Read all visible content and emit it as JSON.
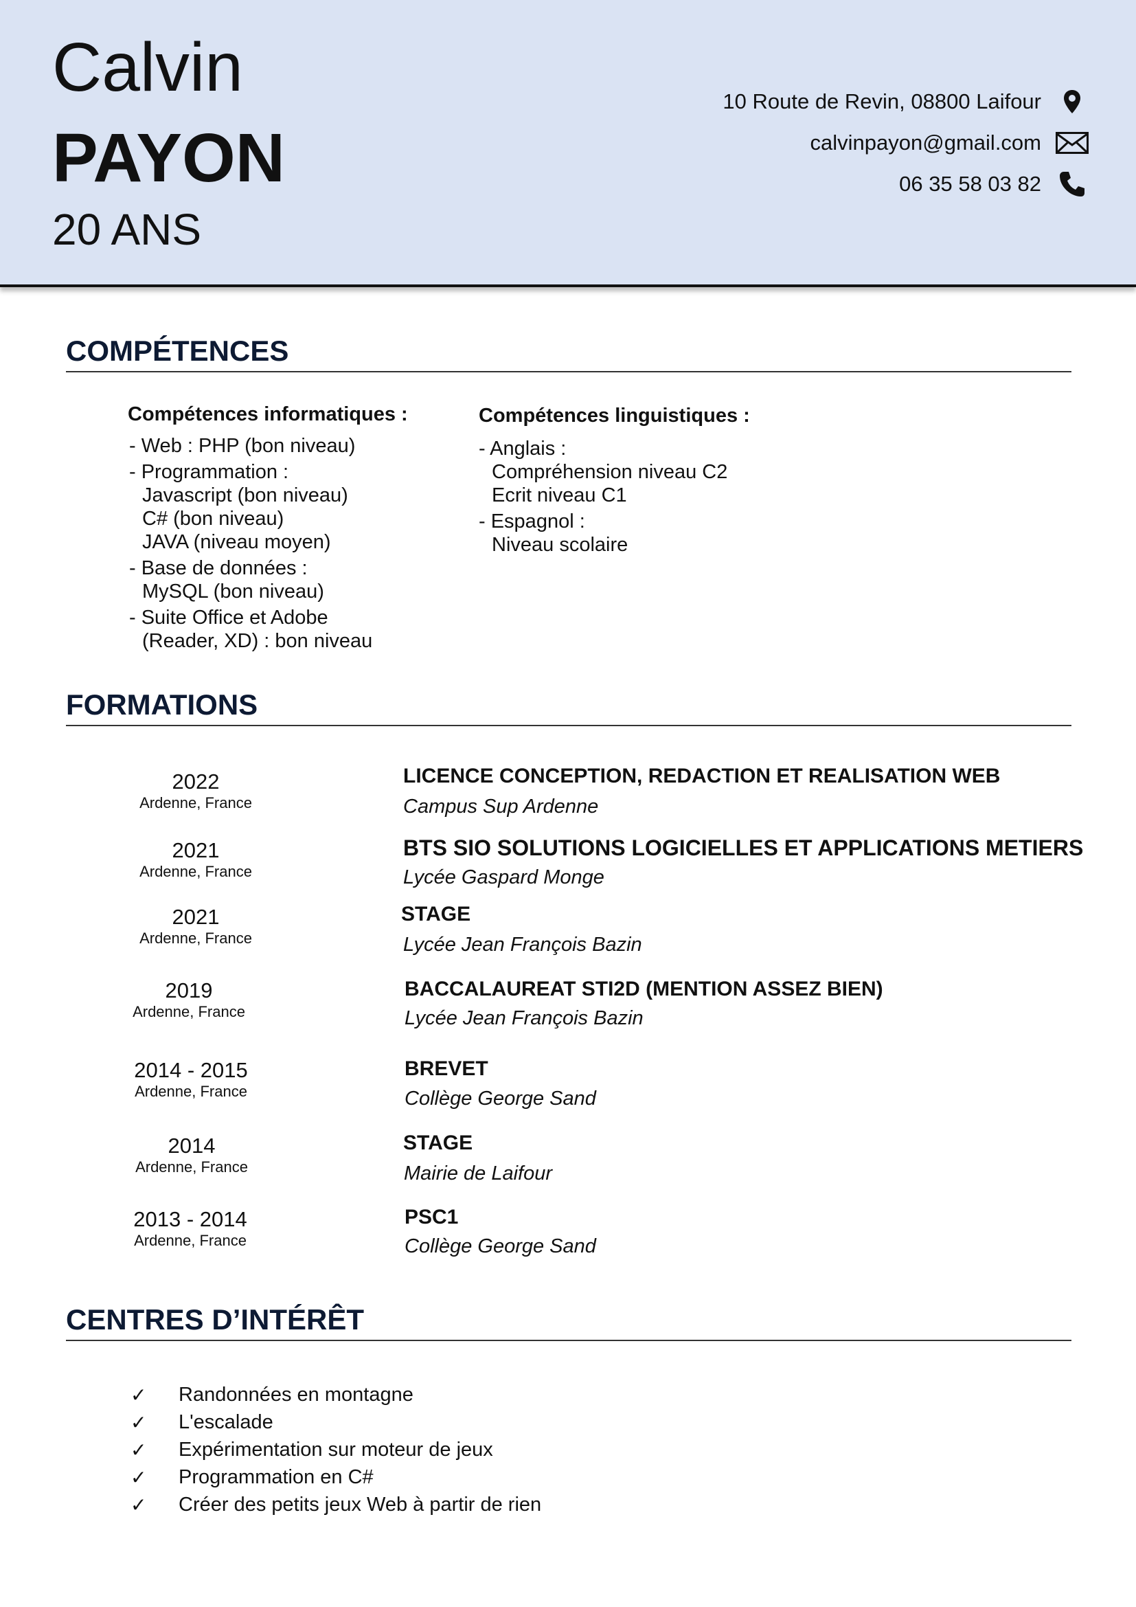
{
  "header": {
    "first_name": "Calvin",
    "last_name": "PAYON",
    "age": "20 ANS",
    "address": "10 Route de Revin, 08800 Laifour",
    "email": "calvinpayon@gmail.com",
    "phone": "06 35  58 03 82",
    "background_color": "#dae3f3"
  },
  "skills": {
    "title": "COMPÉTENCES",
    "it": {
      "heading": "Compétences informatiques :",
      "items": [
        [
          "- Web : PHP (bon niveau)"
        ],
        [
          "- Programmation :",
          "Javascript (bon niveau)",
          "C# (bon niveau)",
          "JAVA (niveau moyen)"
        ],
        [
          "- Base de données :",
          "MySQL (bon niveau)"
        ],
        [
          "- Suite Office et Adobe",
          "(Reader, XD) : bon niveau"
        ]
      ]
    },
    "languages": {
      "heading": "Compétences linguistiques :",
      "items": [
        [
          "- Anglais :",
          "Compréhension niveau C2",
          "Ecrit niveau C1"
        ],
        [
          "- Espagnol :",
          "Niveau scolaire"
        ]
      ]
    }
  },
  "formations": {
    "title": "FORMATIONS",
    "items": [
      {
        "year": "2022",
        "place": "Ardenne, France",
        "title": "LICENCE CONCEPTION, REDACTION ET REALISATION WEB",
        "school": "Campus Sup Ardenne"
      },
      {
        "year": "2021",
        "place": "Ardenne, France",
        "title": "BTS SIO SOLUTIONS LOGICIELLES ET APPLICATIONS METIERS",
        "school": "Lycée Gaspard Monge"
      },
      {
        "year": "2021",
        "place": "Ardenne, France",
        "title": "STAGE",
        "school": "Lycée Jean François Bazin"
      },
      {
        "year": "2019",
        "place": "Ardenne, France",
        "title": "BACCALAUREAT STI2D (MENTION ASSEZ BIEN)",
        "school": "Lycée Jean François Bazin"
      },
      {
        "year": "2014 - 2015",
        "place": "Ardenne, France",
        "title": "BREVET",
        "school": "Collège George Sand"
      },
      {
        "year": "2014",
        "place": "Ardenne, France",
        "title": "STAGE",
        "school": "Mairie de Laifour"
      },
      {
        "year": "2013 - 2014",
        "place": "Ardenne, France",
        "title": "PSC1",
        "school": "Collège George Sand"
      }
    ]
  },
  "interests": {
    "title": "CENTRES D’INTÉRÊT",
    "check_mark": "✓",
    "items": [
      "Randonnées en montagne",
      "L'escalade",
      "Expérimentation sur moteur de jeux",
      "Programmation en C#",
      "Créer des petits jeux Web à partir de rien"
    ]
  }
}
